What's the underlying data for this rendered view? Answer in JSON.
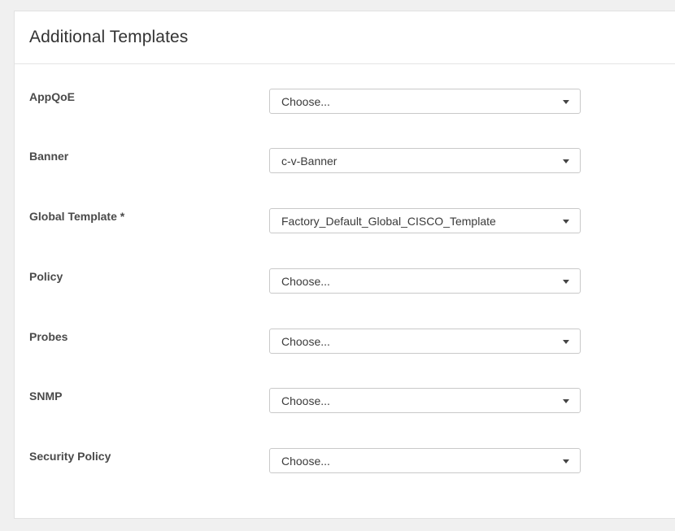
{
  "panel": {
    "title": "Additional Templates"
  },
  "fields": [
    {
      "label": "AppQoE",
      "value": "Choose...",
      "icon": "caret-down-icon"
    },
    {
      "label": "Banner",
      "value": "c-v-Banner",
      "icon": "caret-down-icon"
    },
    {
      "label": "Global Template *",
      "value": "Factory_Default_Global_CISCO_Template",
      "icon": "caret-down-icon"
    },
    {
      "label": "Policy",
      "value": "Choose...",
      "icon": "caret-down-icon"
    },
    {
      "label": "Probes",
      "value": "Choose...",
      "icon": "caret-down-icon"
    },
    {
      "label": "SNMP",
      "value": "Choose...",
      "icon": "caret-down-icon"
    },
    {
      "label": "Security Policy",
      "value": "Choose...",
      "icon": "caret-down-icon"
    }
  ]
}
